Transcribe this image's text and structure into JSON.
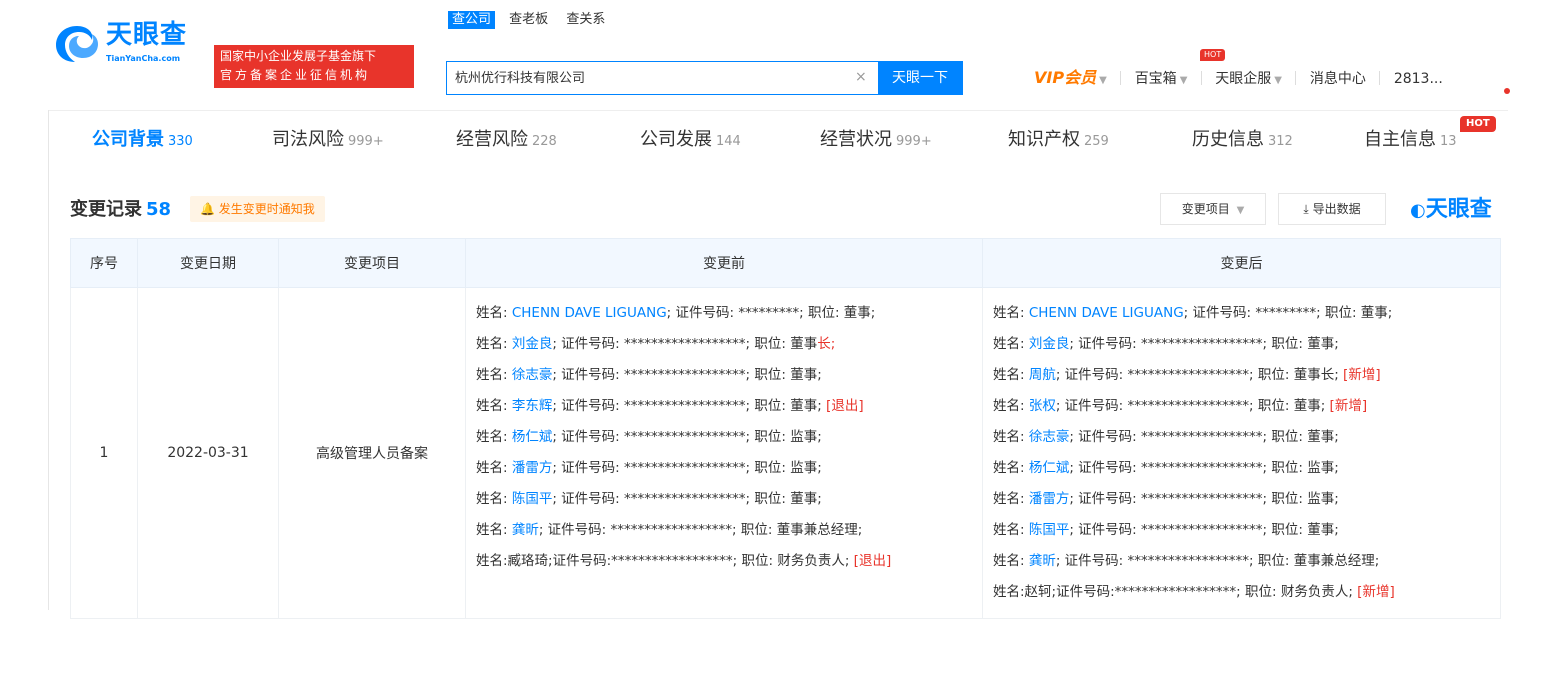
{
  "header": {
    "logo_name": "天眼查",
    "logo_sub": "TianYanCha.com",
    "badge_line1": "国家中小企业发展子基金旗下",
    "badge_line2": "官方备案企业征信机构",
    "search_tabs": [
      "查公司",
      "查老板",
      "查关系"
    ],
    "search_value": "杭州优行科技有限公司",
    "search_clear": "×",
    "search_button": "天眼一下",
    "nav": {
      "vip": "VIP会员",
      "baibaoxiang": "百宝箱",
      "hot": "HOT",
      "enterprise": "天眼企服",
      "messages": "消息中心",
      "user": "2813..."
    }
  },
  "categories": [
    {
      "label": "公司背景",
      "count": "330"
    },
    {
      "label": "司法风险",
      "count": "999+"
    },
    {
      "label": "经营风险",
      "count": "228"
    },
    {
      "label": "公司发展",
      "count": "144"
    },
    {
      "label": "经营状况",
      "count": "999+"
    },
    {
      "label": "知识产权",
      "count": "259"
    },
    {
      "label": "历史信息",
      "count": "312"
    },
    {
      "label": "自主信息",
      "count": "13"
    }
  ],
  "hot_tag": "HOT",
  "section": {
    "title": "变更记录",
    "count": "58",
    "notify": "发生变更时通知我",
    "filter": "变更项目",
    "export": "导出数据",
    "watermark": "天眼查"
  },
  "table": {
    "headers": [
      "序号",
      "变更日期",
      "变更项目",
      "变更前",
      "变更后"
    ],
    "row": {
      "index": "1",
      "date": "2022-03-31",
      "item": "高级管理人员备案",
      "before": [
        {
          "p": "姓名: ",
          "n": "CHENN DAVE LIGUANG",
          "m": "; 证件号码: *********; 职位: 董事;",
          "t": ""
        },
        {
          "p": "姓名: ",
          "n": "刘金良",
          "m": "; 证件号码: ******************; 职位: 董事",
          "t": "长;"
        },
        {
          "p": "姓名: ",
          "n": "徐志豪",
          "m": "; 证件号码: ******************; 职位: 董事;",
          "t": ""
        },
        {
          "p": "姓名: ",
          "n": "李东辉",
          "m": "; 证件号码: ******************; 职位: 董事; ",
          "t": "[退出]"
        },
        {
          "p": "姓名: ",
          "n": "杨仁斌",
          "m": "; 证件号码: ******************; 职位: 监事;",
          "t": ""
        },
        {
          "p": "姓名: ",
          "n": "潘雷方",
          "m": "; 证件号码: ******************; 职位: 监事;",
          "t": ""
        },
        {
          "p": "姓名: ",
          "n": "陈国平",
          "m": "; 证件号码: ******************; 职位: 董事;",
          "t": ""
        },
        {
          "p": "姓名: ",
          "n": "龚昕",
          "m": "; 证件号码: ******************; 职位: 董事兼总经理;",
          "t": ""
        },
        {
          "p": "姓名:臧珞琦;证件号码:******************; 职位: 财务负责人; ",
          "n": "",
          "m": "",
          "t": "[退出]"
        }
      ],
      "after": [
        {
          "p": "姓名: ",
          "n": "CHENN DAVE LIGUANG",
          "m": "; 证件号码: *********; 职位: 董事;",
          "t": ""
        },
        {
          "p": "姓名: ",
          "n": "刘金良",
          "m": "; 证件号码: ******************; 职位: 董事;",
          "t": ""
        },
        {
          "p": "姓名: ",
          "n": "周航",
          "m": "; 证件号码: ******************; 职位: 董事长; ",
          "t": "[新增]"
        },
        {
          "p": "姓名: ",
          "n": "张权",
          "m": "; 证件号码: ******************; 职位: 董事; ",
          "t": "[新增]"
        },
        {
          "p": "姓名: ",
          "n": "徐志豪",
          "m": "; 证件号码: ******************; 职位: 董事;",
          "t": ""
        },
        {
          "p": "姓名: ",
          "n": "杨仁斌",
          "m": "; 证件号码: ******************; 职位: 监事;",
          "t": ""
        },
        {
          "p": "姓名: ",
          "n": "潘雷方",
          "m": "; 证件号码: ******************; 职位: 监事;",
          "t": ""
        },
        {
          "p": "姓名: ",
          "n": "陈国平",
          "m": "; 证件号码: ******************; 职位: 董事;",
          "t": ""
        },
        {
          "p": "姓名: ",
          "n": "龚昕",
          "m": "; 证件号码: ******************; 职位: 董事兼总经理;",
          "t": ""
        },
        {
          "p": "姓名:赵轲;证件号码:******************; 职位: 财务负责人; ",
          "n": "",
          "m": "",
          "t": "[新增]"
        }
      ]
    }
  },
  "colors": {
    "brand": "#0084ff",
    "red": "#e8342b",
    "vip": "#ff7a00"
  }
}
